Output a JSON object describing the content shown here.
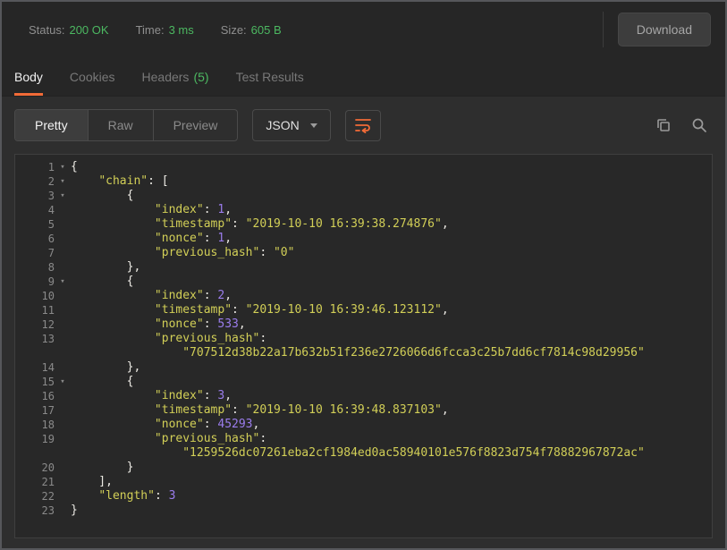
{
  "colors": {
    "accent_orange": "#f26b37",
    "success_green": "#4cb861",
    "string_yellow": "#d2cf57",
    "number_purple": "#9b7ded"
  },
  "status_bar": {
    "items": [
      {
        "id": "status",
        "label": "Status:",
        "value": "200 OK"
      },
      {
        "id": "time",
        "label": "Time:",
        "value": "3 ms"
      },
      {
        "id": "size",
        "label": "Size:",
        "value": "605 B"
      }
    ],
    "download_label": "Download"
  },
  "tabs": [
    {
      "id": "body",
      "label": "Body",
      "active": true
    },
    {
      "id": "cookies",
      "label": "Cookies"
    },
    {
      "id": "headers",
      "label": "Headers",
      "badge": "(5)"
    },
    {
      "id": "test-results",
      "label": "Test Results"
    }
  ],
  "toolbar": {
    "view_modes": [
      {
        "id": "pretty",
        "label": "Pretty",
        "active": true
      },
      {
        "id": "raw",
        "label": "Raw"
      },
      {
        "id": "preview",
        "label": "Preview"
      }
    ],
    "language_select": "JSON",
    "icons": [
      "wrap-text",
      "copy",
      "search"
    ]
  },
  "code": {
    "lines": [
      {
        "n": "1",
        "fold": true,
        "tokens": [
          {
            "t": "p",
            "v": "{"
          }
        ]
      },
      {
        "n": "2",
        "fold": true,
        "tokens": [
          {
            "t": "p",
            "v": "    "
          },
          {
            "t": "k",
            "v": "\"chain\""
          },
          {
            "t": "p",
            "v": ": ["
          }
        ]
      },
      {
        "n": "3",
        "fold": true,
        "tokens": [
          {
            "t": "p",
            "v": "        {"
          }
        ]
      },
      {
        "n": "4",
        "tokens": [
          {
            "t": "p",
            "v": "            "
          },
          {
            "t": "k",
            "v": "\"index\""
          },
          {
            "t": "p",
            "v": ": "
          },
          {
            "t": "n",
            "v": "1"
          },
          {
            "t": "p",
            "v": ","
          }
        ]
      },
      {
        "n": "5",
        "tokens": [
          {
            "t": "p",
            "v": "            "
          },
          {
            "t": "k",
            "v": "\"timestamp\""
          },
          {
            "t": "p",
            "v": ": "
          },
          {
            "t": "s",
            "v": "\"2019-10-10 16:39:38.274876\""
          },
          {
            "t": "p",
            "v": ","
          }
        ]
      },
      {
        "n": "6",
        "tokens": [
          {
            "t": "p",
            "v": "            "
          },
          {
            "t": "k",
            "v": "\"nonce\""
          },
          {
            "t": "p",
            "v": ": "
          },
          {
            "t": "n",
            "v": "1"
          },
          {
            "t": "p",
            "v": ","
          }
        ]
      },
      {
        "n": "7",
        "tokens": [
          {
            "t": "p",
            "v": "            "
          },
          {
            "t": "k",
            "v": "\"previous_hash\""
          },
          {
            "t": "p",
            "v": ": "
          },
          {
            "t": "s",
            "v": "\"0\""
          }
        ]
      },
      {
        "n": "8",
        "tokens": [
          {
            "t": "p",
            "v": "        },"
          }
        ]
      },
      {
        "n": "9",
        "fold": true,
        "tokens": [
          {
            "t": "p",
            "v": "        {"
          }
        ]
      },
      {
        "n": "10",
        "tokens": [
          {
            "t": "p",
            "v": "            "
          },
          {
            "t": "k",
            "v": "\"index\""
          },
          {
            "t": "p",
            "v": ": "
          },
          {
            "t": "n",
            "v": "2"
          },
          {
            "t": "p",
            "v": ","
          }
        ]
      },
      {
        "n": "11",
        "tokens": [
          {
            "t": "p",
            "v": "            "
          },
          {
            "t": "k",
            "v": "\"timestamp\""
          },
          {
            "t": "p",
            "v": ": "
          },
          {
            "t": "s",
            "v": "\"2019-10-10 16:39:46.123112\""
          },
          {
            "t": "p",
            "v": ","
          }
        ]
      },
      {
        "n": "12",
        "tokens": [
          {
            "t": "p",
            "v": "            "
          },
          {
            "t": "k",
            "v": "\"nonce\""
          },
          {
            "t": "p",
            "v": ": "
          },
          {
            "t": "n",
            "v": "533"
          },
          {
            "t": "p",
            "v": ","
          }
        ]
      },
      {
        "n": "13",
        "tokens": [
          {
            "t": "p",
            "v": "            "
          },
          {
            "t": "k",
            "v": "\"previous_hash\""
          },
          {
            "t": "p",
            "v": ":"
          }
        ]
      },
      {
        "n": "",
        "tokens": [
          {
            "t": "p",
            "v": "                "
          },
          {
            "t": "s",
            "v": "\"707512d38b22a17b632b51f236e2726066d6fcca3c25b7dd6cf7814c98d29956\""
          }
        ]
      },
      {
        "n": "14",
        "tokens": [
          {
            "t": "p",
            "v": "        },"
          }
        ]
      },
      {
        "n": "15",
        "fold": true,
        "tokens": [
          {
            "t": "p",
            "v": "        {"
          }
        ]
      },
      {
        "n": "16",
        "tokens": [
          {
            "t": "p",
            "v": "            "
          },
          {
            "t": "k",
            "v": "\"index\""
          },
          {
            "t": "p",
            "v": ": "
          },
          {
            "t": "n",
            "v": "3"
          },
          {
            "t": "p",
            "v": ","
          }
        ]
      },
      {
        "n": "17",
        "tokens": [
          {
            "t": "p",
            "v": "            "
          },
          {
            "t": "k",
            "v": "\"timestamp\""
          },
          {
            "t": "p",
            "v": ": "
          },
          {
            "t": "s",
            "v": "\"2019-10-10 16:39:48.837103\""
          },
          {
            "t": "p",
            "v": ","
          }
        ]
      },
      {
        "n": "18",
        "tokens": [
          {
            "t": "p",
            "v": "            "
          },
          {
            "t": "k",
            "v": "\"nonce\""
          },
          {
            "t": "p",
            "v": ": "
          },
          {
            "t": "n",
            "v": "45293"
          },
          {
            "t": "p",
            "v": ","
          }
        ]
      },
      {
        "n": "19",
        "tokens": [
          {
            "t": "p",
            "v": "            "
          },
          {
            "t": "k",
            "v": "\"previous_hash\""
          },
          {
            "t": "p",
            "v": ":"
          }
        ]
      },
      {
        "n": "",
        "tokens": [
          {
            "t": "p",
            "v": "                "
          },
          {
            "t": "s",
            "v": "\"1259526dc07261eba2cf1984ed0ac58940101e576f8823d754f78882967872ac\""
          }
        ]
      },
      {
        "n": "20",
        "tokens": [
          {
            "t": "p",
            "v": "        }"
          }
        ]
      },
      {
        "n": "21",
        "tokens": [
          {
            "t": "p",
            "v": "    ],"
          }
        ]
      },
      {
        "n": "22",
        "tokens": [
          {
            "t": "p",
            "v": "    "
          },
          {
            "t": "k",
            "v": "\"length\""
          },
          {
            "t": "p",
            "v": ": "
          },
          {
            "t": "n",
            "v": "3"
          }
        ]
      },
      {
        "n": "23",
        "tokens": [
          {
            "t": "p",
            "v": "}"
          }
        ]
      }
    ]
  }
}
